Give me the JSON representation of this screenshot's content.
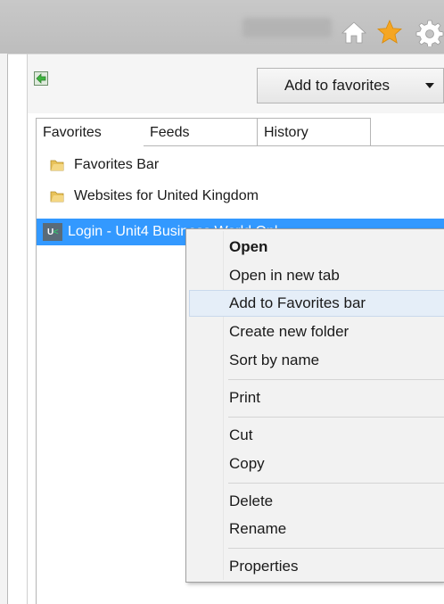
{
  "toolbar": {
    "home_icon": "home-icon",
    "favorites_icon": "star-icon",
    "tools_icon": "gear-icon",
    "add_to_favorites_label": "Add to favorites",
    "dropdown_icon": "triangle-down-icon"
  },
  "tabs": [
    {
      "label": "Favorites",
      "selected": true
    },
    {
      "label": "Feeds",
      "selected": false
    },
    {
      "label": "History",
      "selected": false
    }
  ],
  "favorites_list": [
    {
      "label": "Favorites Bar",
      "icon": "folder-icon"
    },
    {
      "label": "Websites for United Kingdom",
      "icon": "folder-icon"
    },
    {
      "label": "Login - Unit4 Business World Onl",
      "icon": "site-favicon",
      "selected": true,
      "favicon_text": "U",
      "favicon_accent": "<"
    }
  ],
  "context_menu": {
    "items": [
      {
        "label": "Open",
        "bold": true
      },
      {
        "label": "Open in new tab"
      },
      {
        "label": "Add to Favorites bar",
        "highlighted": true
      },
      {
        "label": "Create new folder"
      },
      {
        "label": "Sort by name"
      },
      {
        "label": "Print"
      },
      {
        "label": "Cut"
      },
      {
        "label": "Copy"
      },
      {
        "label": "Delete"
      },
      {
        "label": "Rename"
      },
      {
        "label": "Properties"
      }
    ]
  },
  "colors": {
    "selection": "#3399ff",
    "star": "#f5a623",
    "menu_hover": "#e5eef8"
  }
}
